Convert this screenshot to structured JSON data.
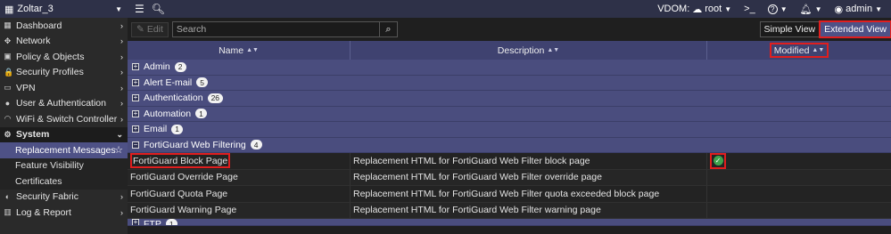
{
  "topbar": {
    "device_name": "Zoltar_3",
    "vdom_label": "VDOM:",
    "vdom_value": "root",
    "user": "admin",
    "cli_icon": ">_",
    "help_icon": "?"
  },
  "sidebar": {
    "items": [
      {
        "label": "Dashboard",
        "icon": "dashboard-icon",
        "glyph": "▦"
      },
      {
        "label": "Network",
        "icon": "network-icon",
        "glyph": "✥"
      },
      {
        "label": "Policy & Objects",
        "icon": "policy-icon",
        "glyph": "▣"
      },
      {
        "label": "Security Profiles",
        "icon": "lock-icon",
        "glyph": "🔒"
      },
      {
        "label": "VPN",
        "icon": "monitor-icon",
        "glyph": "▭"
      },
      {
        "label": "User & Authentication",
        "icon": "user-icon",
        "glyph": "●"
      },
      {
        "label": "WiFi & Switch Controller",
        "icon": "wifi-icon",
        "glyph": "◠"
      }
    ],
    "section": {
      "label": "System",
      "icon": "gear-icon",
      "glyph": "⚙"
    },
    "sub_items": [
      {
        "label": "Replacement Messages"
      },
      {
        "label": "Feature Visibility"
      },
      {
        "label": "Certificates"
      }
    ],
    "bottom_items": [
      {
        "label": "Security Fabric",
        "icon": "fabric-icon",
        "glyph": "◐"
      },
      {
        "label": "Log & Report",
        "icon": "chart-icon",
        "glyph": "▥"
      }
    ]
  },
  "toolbar": {
    "edit_label": "Edit",
    "search_placeholder": "Search",
    "simple_view": "Simple View",
    "extended_view": "Extended View"
  },
  "table": {
    "columns": [
      "Name",
      "Description",
      "Modified"
    ],
    "groups": [
      {
        "label": "Admin",
        "count": "2"
      },
      {
        "label": "Alert E-mail",
        "count": "5"
      },
      {
        "label": "Authentication",
        "count": "26"
      },
      {
        "label": "Automation",
        "count": "1"
      },
      {
        "label": "Email",
        "count": "1"
      }
    ],
    "expanded_group": {
      "label": "FortiGuard Web Filtering",
      "count": "4"
    },
    "rows": [
      {
        "name": "FortiGuard Block Page",
        "description": "Replacement HTML for FortiGuard Web Filter block page",
        "modified": true
      },
      {
        "name": "FortiGuard Override Page",
        "description": "Replacement HTML for FortiGuard Web Filter override page",
        "modified": false
      },
      {
        "name": "FortiGuard Quota Page",
        "description": "Replacement HTML for FortiGuard Web Filter quota exceeded block page",
        "modified": false
      },
      {
        "name": "FortiGuard Warning Page",
        "description": "Replacement HTML for FortiGuard Web Filter warning page",
        "modified": false
      }
    ],
    "next_group": {
      "label": "FTP",
      "count": "1"
    }
  },
  "colors": {
    "accent": "#4e5186",
    "header": "#3f4270",
    "highlight": "#e01e1e",
    "check": "#3fa34d"
  }
}
